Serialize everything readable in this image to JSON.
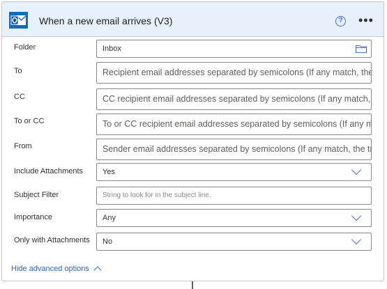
{
  "header": {
    "title": "When a new email arrives (V3)",
    "app_icon": "outlook-icon",
    "help_icon": "help-icon",
    "help_glyph": "?",
    "more_icon": "more-icon",
    "more_glyph": "•••"
  },
  "fields": {
    "folder": {
      "label": "Folder",
      "value": "Inbox"
    },
    "to": {
      "label": "To",
      "placeholder": "Recipient email addresses separated by semicolons (If any match, the"
    },
    "cc": {
      "label": "CC",
      "placeholder": "CC recipient email addresses separated by semicolons (If any match, t"
    },
    "to_or_cc": {
      "label": "To or CC",
      "placeholder": "To or CC recipient email addresses separated by semicolons (If any m"
    },
    "from": {
      "label": "From",
      "placeholder": "Sender email addresses separated by semicolons (If any match, the tr"
    },
    "include_attachments": {
      "label": "Include Attachments",
      "value": "Yes"
    },
    "subject_filter": {
      "label": "Subject Filter",
      "placeholder": "String to look for in the subject line."
    },
    "importance": {
      "label": "Importance",
      "value": "Any"
    },
    "only_with_attachments": {
      "label": "Only with Attachments",
      "value": "No"
    }
  },
  "footer": {
    "advanced_label": "Hide advanced options"
  },
  "colors": {
    "accent": "#2d63b8",
    "header_bg": "#e7f1fb",
    "outlook_blue": "#0f6cbd"
  }
}
